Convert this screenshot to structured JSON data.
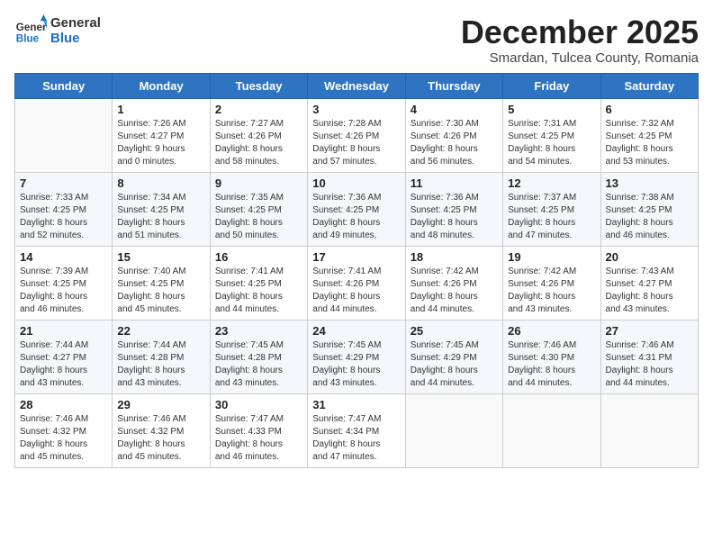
{
  "header": {
    "logo_line1": "General",
    "logo_line2": "Blue",
    "title": "December 2025",
    "subtitle": "Smardan, Tulcea County, Romania"
  },
  "weekdays": [
    "Sunday",
    "Monday",
    "Tuesday",
    "Wednesday",
    "Thursday",
    "Friday",
    "Saturday"
  ],
  "weeks": [
    [
      {
        "num": "",
        "detail": ""
      },
      {
        "num": "1",
        "detail": "Sunrise: 7:26 AM\nSunset: 4:27 PM\nDaylight: 9 hours\nand 0 minutes."
      },
      {
        "num": "2",
        "detail": "Sunrise: 7:27 AM\nSunset: 4:26 PM\nDaylight: 8 hours\nand 58 minutes."
      },
      {
        "num": "3",
        "detail": "Sunrise: 7:28 AM\nSunset: 4:26 PM\nDaylight: 8 hours\nand 57 minutes."
      },
      {
        "num": "4",
        "detail": "Sunrise: 7:30 AM\nSunset: 4:26 PM\nDaylight: 8 hours\nand 56 minutes."
      },
      {
        "num": "5",
        "detail": "Sunrise: 7:31 AM\nSunset: 4:25 PM\nDaylight: 8 hours\nand 54 minutes."
      },
      {
        "num": "6",
        "detail": "Sunrise: 7:32 AM\nSunset: 4:25 PM\nDaylight: 8 hours\nand 53 minutes."
      }
    ],
    [
      {
        "num": "7",
        "detail": "Sunrise: 7:33 AM\nSunset: 4:25 PM\nDaylight: 8 hours\nand 52 minutes."
      },
      {
        "num": "8",
        "detail": "Sunrise: 7:34 AM\nSunset: 4:25 PM\nDaylight: 8 hours\nand 51 minutes."
      },
      {
        "num": "9",
        "detail": "Sunrise: 7:35 AM\nSunset: 4:25 PM\nDaylight: 8 hours\nand 50 minutes."
      },
      {
        "num": "10",
        "detail": "Sunrise: 7:36 AM\nSunset: 4:25 PM\nDaylight: 8 hours\nand 49 minutes."
      },
      {
        "num": "11",
        "detail": "Sunrise: 7:36 AM\nSunset: 4:25 PM\nDaylight: 8 hours\nand 48 minutes."
      },
      {
        "num": "12",
        "detail": "Sunrise: 7:37 AM\nSunset: 4:25 PM\nDaylight: 8 hours\nand 47 minutes."
      },
      {
        "num": "13",
        "detail": "Sunrise: 7:38 AM\nSunset: 4:25 PM\nDaylight: 8 hours\nand 46 minutes."
      }
    ],
    [
      {
        "num": "14",
        "detail": "Sunrise: 7:39 AM\nSunset: 4:25 PM\nDaylight: 8 hours\nand 46 minutes."
      },
      {
        "num": "15",
        "detail": "Sunrise: 7:40 AM\nSunset: 4:25 PM\nDaylight: 8 hours\nand 45 minutes."
      },
      {
        "num": "16",
        "detail": "Sunrise: 7:41 AM\nSunset: 4:25 PM\nDaylight: 8 hours\nand 44 minutes."
      },
      {
        "num": "17",
        "detail": "Sunrise: 7:41 AM\nSunset: 4:26 PM\nDaylight: 8 hours\nand 44 minutes."
      },
      {
        "num": "18",
        "detail": "Sunrise: 7:42 AM\nSunset: 4:26 PM\nDaylight: 8 hours\nand 44 minutes."
      },
      {
        "num": "19",
        "detail": "Sunrise: 7:42 AM\nSunset: 4:26 PM\nDaylight: 8 hours\nand 43 minutes."
      },
      {
        "num": "20",
        "detail": "Sunrise: 7:43 AM\nSunset: 4:27 PM\nDaylight: 8 hours\nand 43 minutes."
      }
    ],
    [
      {
        "num": "21",
        "detail": "Sunrise: 7:44 AM\nSunset: 4:27 PM\nDaylight: 8 hours\nand 43 minutes."
      },
      {
        "num": "22",
        "detail": "Sunrise: 7:44 AM\nSunset: 4:28 PM\nDaylight: 8 hours\nand 43 minutes."
      },
      {
        "num": "23",
        "detail": "Sunrise: 7:45 AM\nSunset: 4:28 PM\nDaylight: 8 hours\nand 43 minutes."
      },
      {
        "num": "24",
        "detail": "Sunrise: 7:45 AM\nSunset: 4:29 PM\nDaylight: 8 hours\nand 43 minutes."
      },
      {
        "num": "25",
        "detail": "Sunrise: 7:45 AM\nSunset: 4:29 PM\nDaylight: 8 hours\nand 44 minutes."
      },
      {
        "num": "26",
        "detail": "Sunrise: 7:46 AM\nSunset: 4:30 PM\nDaylight: 8 hours\nand 44 minutes."
      },
      {
        "num": "27",
        "detail": "Sunrise: 7:46 AM\nSunset: 4:31 PM\nDaylight: 8 hours\nand 44 minutes."
      }
    ],
    [
      {
        "num": "28",
        "detail": "Sunrise: 7:46 AM\nSunset: 4:32 PM\nDaylight: 8 hours\nand 45 minutes."
      },
      {
        "num": "29",
        "detail": "Sunrise: 7:46 AM\nSunset: 4:32 PM\nDaylight: 8 hours\nand 45 minutes."
      },
      {
        "num": "30",
        "detail": "Sunrise: 7:47 AM\nSunset: 4:33 PM\nDaylight: 8 hours\nand 46 minutes."
      },
      {
        "num": "31",
        "detail": "Sunrise: 7:47 AM\nSunset: 4:34 PM\nDaylight: 8 hours\nand 47 minutes."
      },
      {
        "num": "",
        "detail": ""
      },
      {
        "num": "",
        "detail": ""
      },
      {
        "num": "",
        "detail": ""
      }
    ]
  ]
}
